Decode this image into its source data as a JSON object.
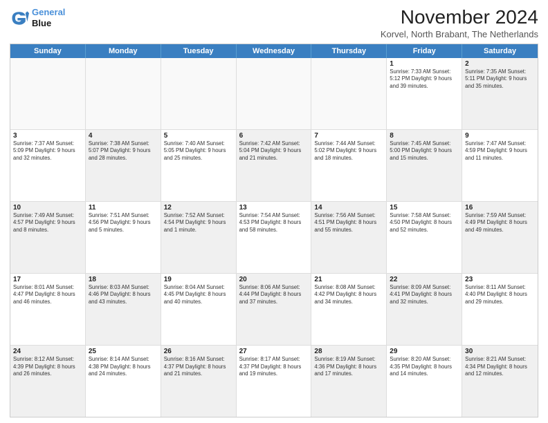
{
  "logo": {
    "line1": "General",
    "line2": "Blue"
  },
  "title": "November 2024",
  "location": "Korvel, North Brabant, The Netherlands",
  "days": [
    "Sunday",
    "Monday",
    "Tuesday",
    "Wednesday",
    "Thursday",
    "Friday",
    "Saturday"
  ],
  "rows": [
    [
      {
        "day": "",
        "detail": "",
        "empty": true
      },
      {
        "day": "",
        "detail": "",
        "empty": true
      },
      {
        "day": "",
        "detail": "",
        "empty": true
      },
      {
        "day": "",
        "detail": "",
        "empty": true
      },
      {
        "day": "",
        "detail": "",
        "empty": true
      },
      {
        "day": "1",
        "detail": "Sunrise: 7:33 AM\nSunset: 5:12 PM\nDaylight: 9 hours\nand 39 minutes."
      },
      {
        "day": "2",
        "detail": "Sunrise: 7:35 AM\nSunset: 5:11 PM\nDaylight: 9 hours\nand 35 minutes.",
        "shaded": true
      }
    ],
    [
      {
        "day": "3",
        "detail": "Sunrise: 7:37 AM\nSunset: 5:09 PM\nDaylight: 9 hours\nand 32 minutes."
      },
      {
        "day": "4",
        "detail": "Sunrise: 7:38 AM\nSunset: 5:07 PM\nDaylight: 9 hours\nand 28 minutes.",
        "shaded": true
      },
      {
        "day": "5",
        "detail": "Sunrise: 7:40 AM\nSunset: 5:05 PM\nDaylight: 9 hours\nand 25 minutes."
      },
      {
        "day": "6",
        "detail": "Sunrise: 7:42 AM\nSunset: 5:04 PM\nDaylight: 9 hours\nand 21 minutes.",
        "shaded": true
      },
      {
        "day": "7",
        "detail": "Sunrise: 7:44 AM\nSunset: 5:02 PM\nDaylight: 9 hours\nand 18 minutes."
      },
      {
        "day": "8",
        "detail": "Sunrise: 7:45 AM\nSunset: 5:00 PM\nDaylight: 9 hours\nand 15 minutes.",
        "shaded": true
      },
      {
        "day": "9",
        "detail": "Sunrise: 7:47 AM\nSunset: 4:59 PM\nDaylight: 9 hours\nand 11 minutes."
      }
    ],
    [
      {
        "day": "10",
        "detail": "Sunrise: 7:49 AM\nSunset: 4:57 PM\nDaylight: 9 hours\nand 8 minutes.",
        "shaded": true
      },
      {
        "day": "11",
        "detail": "Sunrise: 7:51 AM\nSunset: 4:56 PM\nDaylight: 9 hours\nand 5 minutes."
      },
      {
        "day": "12",
        "detail": "Sunrise: 7:52 AM\nSunset: 4:54 PM\nDaylight: 9 hours\nand 1 minute.",
        "shaded": true
      },
      {
        "day": "13",
        "detail": "Sunrise: 7:54 AM\nSunset: 4:53 PM\nDaylight: 8 hours\nand 58 minutes."
      },
      {
        "day": "14",
        "detail": "Sunrise: 7:56 AM\nSunset: 4:51 PM\nDaylight: 8 hours\nand 55 minutes.",
        "shaded": true
      },
      {
        "day": "15",
        "detail": "Sunrise: 7:58 AM\nSunset: 4:50 PM\nDaylight: 8 hours\nand 52 minutes."
      },
      {
        "day": "16",
        "detail": "Sunrise: 7:59 AM\nSunset: 4:49 PM\nDaylight: 8 hours\nand 49 minutes.",
        "shaded": true
      }
    ],
    [
      {
        "day": "17",
        "detail": "Sunrise: 8:01 AM\nSunset: 4:47 PM\nDaylight: 8 hours\nand 46 minutes."
      },
      {
        "day": "18",
        "detail": "Sunrise: 8:03 AM\nSunset: 4:46 PM\nDaylight: 8 hours\nand 43 minutes.",
        "shaded": true
      },
      {
        "day": "19",
        "detail": "Sunrise: 8:04 AM\nSunset: 4:45 PM\nDaylight: 8 hours\nand 40 minutes."
      },
      {
        "day": "20",
        "detail": "Sunrise: 8:06 AM\nSunset: 4:44 PM\nDaylight: 8 hours\nand 37 minutes.",
        "shaded": true
      },
      {
        "day": "21",
        "detail": "Sunrise: 8:08 AM\nSunset: 4:42 PM\nDaylight: 8 hours\nand 34 minutes."
      },
      {
        "day": "22",
        "detail": "Sunrise: 8:09 AM\nSunset: 4:41 PM\nDaylight: 8 hours\nand 32 minutes.",
        "shaded": true
      },
      {
        "day": "23",
        "detail": "Sunrise: 8:11 AM\nSunset: 4:40 PM\nDaylight: 8 hours\nand 29 minutes."
      }
    ],
    [
      {
        "day": "24",
        "detail": "Sunrise: 8:12 AM\nSunset: 4:39 PM\nDaylight: 8 hours\nand 26 minutes.",
        "shaded": true
      },
      {
        "day": "25",
        "detail": "Sunrise: 8:14 AM\nSunset: 4:38 PM\nDaylight: 8 hours\nand 24 minutes."
      },
      {
        "day": "26",
        "detail": "Sunrise: 8:16 AM\nSunset: 4:37 PM\nDaylight: 8 hours\nand 21 minutes.",
        "shaded": true
      },
      {
        "day": "27",
        "detail": "Sunrise: 8:17 AM\nSunset: 4:37 PM\nDaylight: 8 hours\nand 19 minutes."
      },
      {
        "day": "28",
        "detail": "Sunrise: 8:19 AM\nSunset: 4:36 PM\nDaylight: 8 hours\nand 17 minutes.",
        "shaded": true
      },
      {
        "day": "29",
        "detail": "Sunrise: 8:20 AM\nSunset: 4:35 PM\nDaylight: 8 hours\nand 14 minutes."
      },
      {
        "day": "30",
        "detail": "Sunrise: 8:21 AM\nSunset: 4:34 PM\nDaylight: 8 hours\nand 12 minutes.",
        "shaded": true
      }
    ]
  ]
}
